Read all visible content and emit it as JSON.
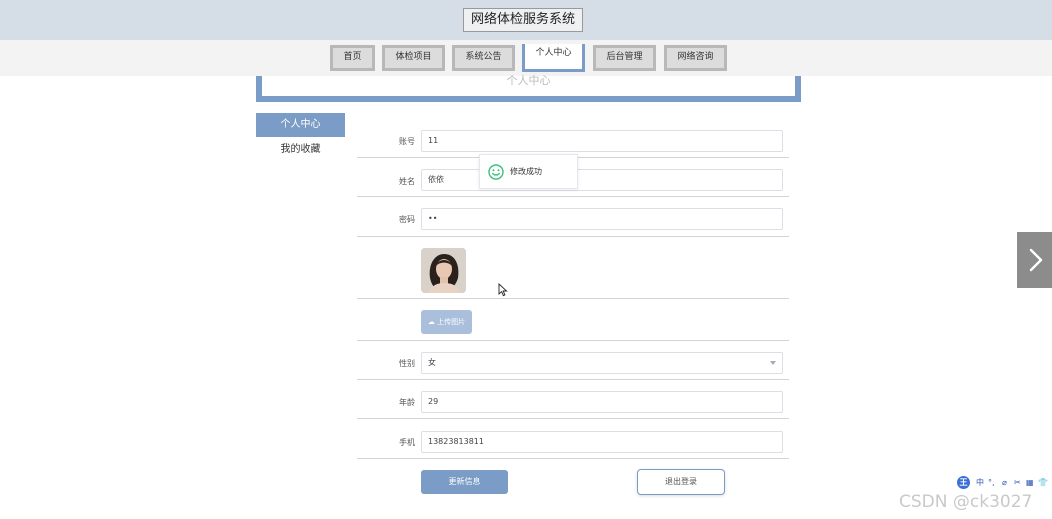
{
  "header": {
    "site_title": "网络体检服务系统"
  },
  "nav": {
    "items": [
      {
        "label": "首页"
      },
      {
        "label": "体检项目"
      },
      {
        "label": "系统公告"
      },
      {
        "label": "个人中心",
        "active": true
      },
      {
        "label": "后台管理"
      },
      {
        "label": "网络咨询"
      }
    ]
  },
  "panel": {
    "title": "个人中心"
  },
  "sidebar": {
    "items": [
      {
        "label": "个人中心",
        "active": true
      },
      {
        "label": "我的收藏"
      }
    ]
  },
  "form": {
    "account": {
      "label": "账号",
      "value": "11"
    },
    "name": {
      "label": "姓名",
      "value": "依依"
    },
    "password": {
      "label": "密码",
      "value": "••"
    },
    "upload_label": "上传图片",
    "gender": {
      "label": "性别",
      "value": "女"
    },
    "age": {
      "label": "年龄",
      "value": "29"
    },
    "phone": {
      "label": "手机",
      "value": "13823813811"
    }
  },
  "toast": {
    "message": "修改成功"
  },
  "actions": {
    "update_label": "更新信息",
    "logout_label": "退出登录"
  },
  "ime": {
    "logo": "王",
    "glyphs": [
      "中",
      "°,",
      "⌀",
      "✂",
      "▦",
      "👕"
    ]
  },
  "watermark": "CSDN @ck3027",
  "colors": {
    "accent": "#7a9cc6",
    "header_bg": "#d5dde6",
    "success": "#3cbf7a"
  }
}
